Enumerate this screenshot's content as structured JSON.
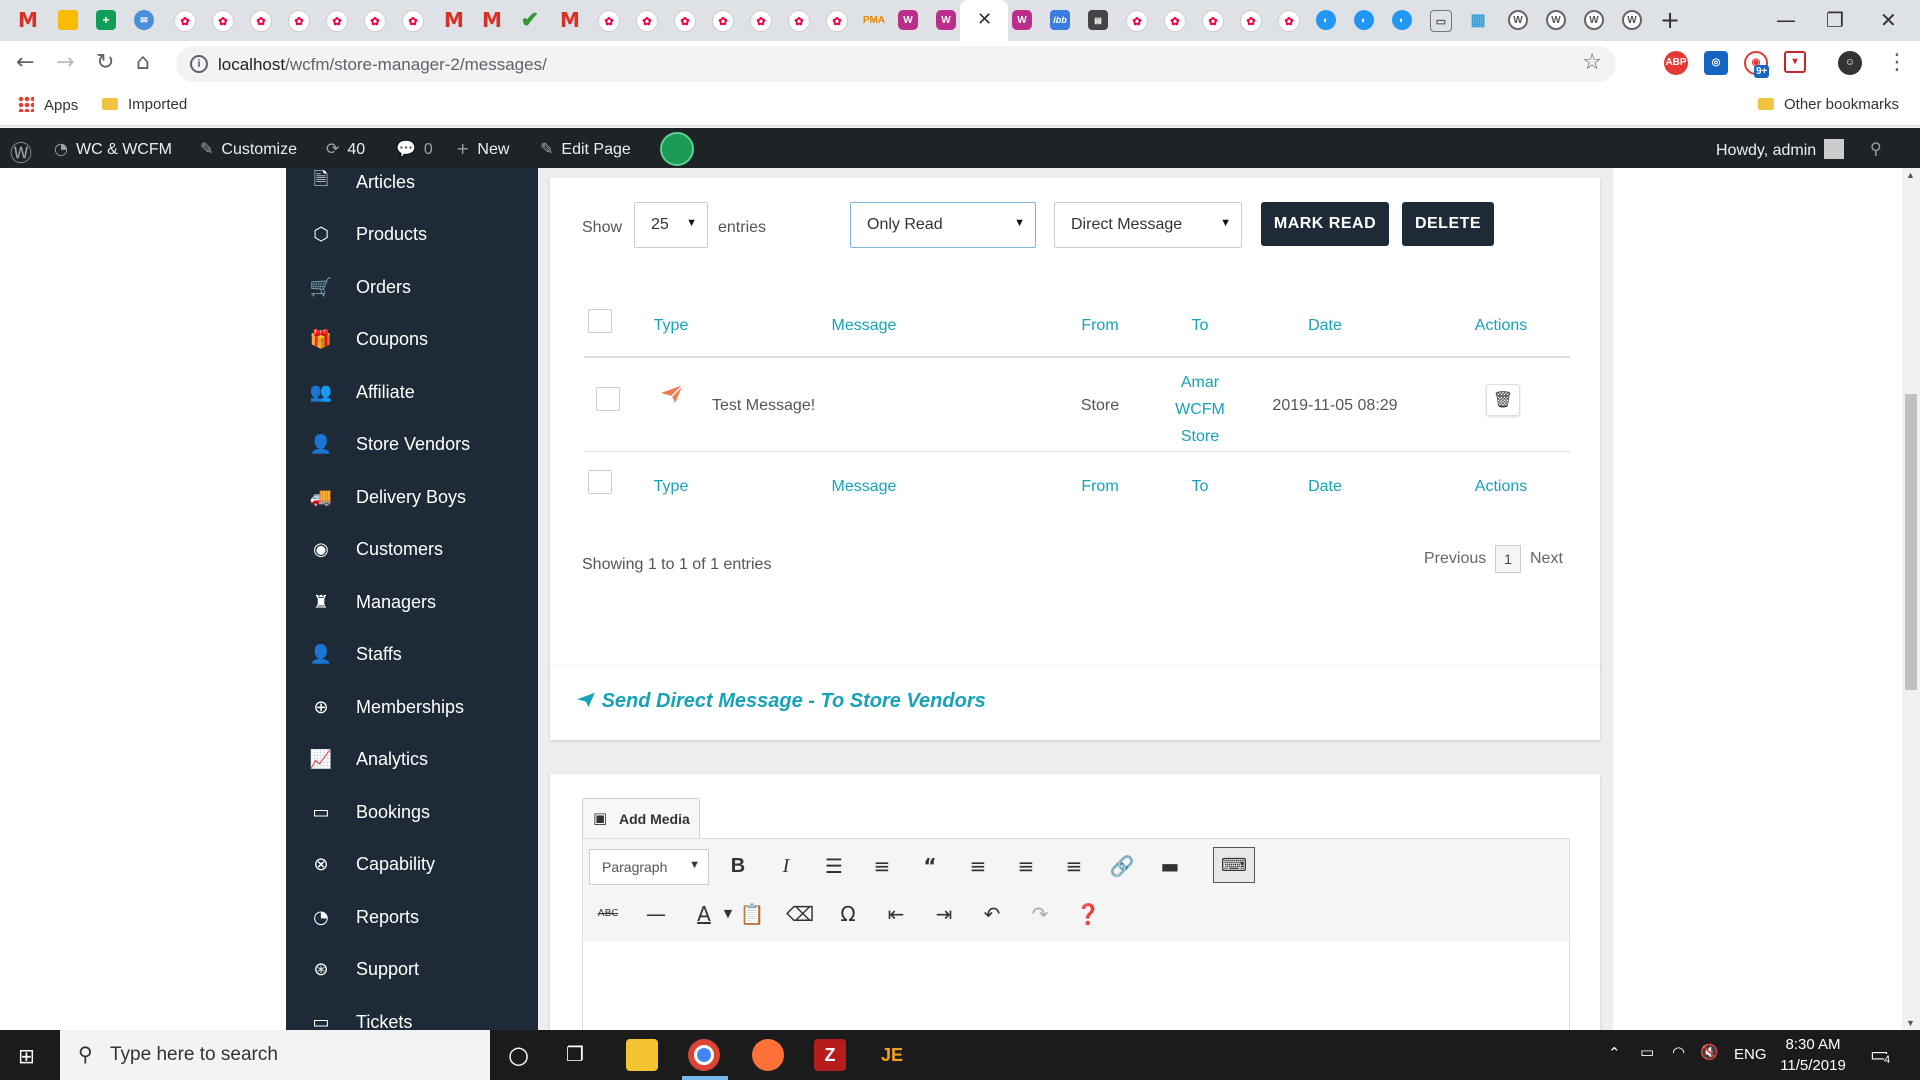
{
  "browser": {
    "url_host": "localhost",
    "url_path": "/wcfm/store-manager-2/messages/",
    "bookmarks": {
      "apps": "Apps",
      "imported": "Imported",
      "other": "Other bookmarks"
    },
    "extension_badge": "9+"
  },
  "admin_bar": {
    "site_name": "WC & WCFM",
    "customize": "Customize",
    "updates": "40",
    "comments": "0",
    "new": "New",
    "edit_page": "Edit Page",
    "greeting": "Howdy, admin"
  },
  "sidebar": {
    "items": [
      {
        "label": "Articles",
        "icon": "article-icon"
      },
      {
        "label": "Products",
        "icon": "box-icon"
      },
      {
        "label": "Orders",
        "icon": "cart-icon"
      },
      {
        "label": "Coupons",
        "icon": "gift-icon"
      },
      {
        "label": "Affiliate",
        "icon": "users-icon"
      },
      {
        "label": "Store Vendors",
        "icon": "user-icon"
      },
      {
        "label": "Delivery Boys",
        "icon": "truck-icon"
      },
      {
        "label": "Customers",
        "icon": "user-circle-icon"
      },
      {
        "label": "Managers",
        "icon": "manager-icon"
      },
      {
        "label": "Staffs",
        "icon": "user-icon"
      },
      {
        "label": "Memberships",
        "icon": "user-plus-icon"
      },
      {
        "label": "Analytics",
        "icon": "chart-icon"
      },
      {
        "label": "Bookings",
        "icon": "calendar-icon"
      },
      {
        "label": "Capability",
        "icon": "user-x-icon"
      },
      {
        "label": "Reports",
        "icon": "pie-icon"
      },
      {
        "label": "Support",
        "icon": "lifebuoy-icon"
      },
      {
        "label": "Tickets",
        "icon": "ticket-icon"
      }
    ]
  },
  "messages": {
    "show_label": "Show",
    "entries_label": "entries",
    "page_length": "25",
    "status_filter": "Only Read",
    "type_filter": "Direct Message",
    "mark_read": "MARK READ",
    "delete": "DELETE",
    "columns": [
      "Type",
      "Message",
      "From",
      "To",
      "Date",
      "Actions"
    ],
    "rows": [
      {
        "message": "Test Message!",
        "from": "Store",
        "to_lines": [
          "Amar",
          "WCFM",
          "Store"
        ],
        "date": "2019-11-05 08:29"
      }
    ],
    "info": "Showing 1 to 1 of 1 entries",
    "previous": "Previous",
    "page": "1",
    "next": "Next"
  },
  "send_section": {
    "title": "Send Direct Message - To Store Vendors"
  },
  "editor": {
    "add_media": "Add Media",
    "format": "Paragraph"
  },
  "taskbar": {
    "search_placeholder": "Type here to search",
    "lang": "ENG",
    "time": "8:30 AM",
    "date": "11/5/2019",
    "notifications": "4"
  },
  "colors": {
    "accent": "#17a2b8",
    "sidebar": "#1e2a38",
    "send_icon": "#f07b52"
  }
}
